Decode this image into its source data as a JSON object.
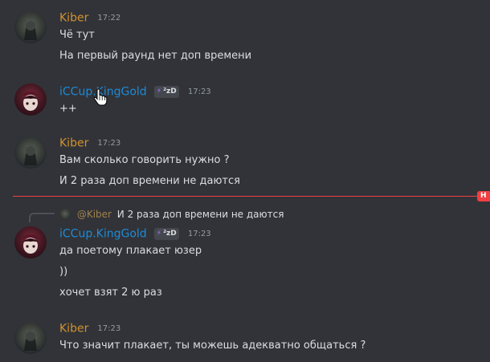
{
  "messages": [
    {
      "author": "Kiber",
      "time": "17:22",
      "lines": [
        "Чё тут",
        "На первый раунд нет доп времени"
      ]
    },
    {
      "author": "iCCup.KingGold",
      "tag": "²zD",
      "time": "17:23",
      "lines": [
        "++"
      ]
    },
    {
      "author": "Kiber",
      "time": "17:23",
      "lines": [
        "Вам сколько говорить нужно ?",
        "И 2 раза доп времени не даются"
      ]
    },
    {
      "reply": {
        "author": "@Kiber",
        "text": "И 2 раза доп времени не даются"
      },
      "author": "iCCup.KingGold",
      "tag": "²zD",
      "time": "17:23",
      "lines": [
        "да поетому плакает юзер",
        "))",
        "хочет взят 2 ю раз"
      ]
    },
    {
      "author": "Kiber",
      "time": "17:23",
      "lines": [
        "Что значит плакает, ты можешь адекватно общаться ?"
      ]
    }
  ],
  "divider": {
    "badge": "Н"
  },
  "colors": {
    "background": "#313338",
    "kiber_name": "#d1912f",
    "kinggold_name": "#1e8ad6",
    "new_divider": "#f23f43",
    "text": "#dbdee1",
    "timestamp": "#949ba4"
  },
  "icons": {
    "tag_icon": "bolt-icon",
    "cursor": "hand-pointer-icon"
  }
}
